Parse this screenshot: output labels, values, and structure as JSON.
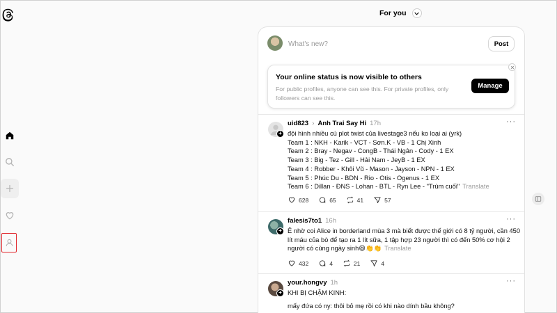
{
  "feed": {
    "title": "For you"
  },
  "composer": {
    "placeholder": "What's new?",
    "post_label": "Post"
  },
  "notice": {
    "title": "Your online status is now visible to others",
    "body": "For public profiles, anyone can see this. For private profiles, only followers can see this.",
    "manage_label": "Manage"
  },
  "posts": [
    {
      "user": "uid823",
      "reply_to": "Anh Trai Say Hi",
      "time": "17h",
      "lines": [
        "đội hình nhiều cú plot twist của livestage3 nếu ko loại ai (yrk)",
        "Team 1 : NKH - Karik - VCT - Sơn.K - VB - 1 Chị Xinh",
        "Team 2 : Bray - Negav - CongB - Thái Ngân - Cody - 1 EX",
        "Team 3 : Big - Tez - Gill - Hải Nam - JeyB - 1 EX",
        "Team 4 : Robber - Khôi Vũ - Mason - Jayson - NPN - 1 EX",
        "Team 5 : Phúc Du - BDN - Rio - Otis - Ogenus - 1 EX",
        "Team 6 : Dillan - ĐNS - Lohan - BTL - Ryn Lee - \"Trùm cuối\""
      ],
      "translate": "Translate",
      "likes": "628",
      "comments": "65",
      "reposts": "41",
      "shares": "57"
    },
    {
      "user": "falesis7to1",
      "time": "16h",
      "lines": [
        "Ê nhờ coi Alice in borderland mùa 3 mà biết được thế giới có 8 tỷ người, cần 450",
        "lít máu của bò để tạo ra 1 lít sữa, 1 tập hợp 23 người thì có đến 50% cơ hội 2",
        "người có cùng ngày sinh😆👏👏"
      ],
      "translate": "Translate",
      "likes": "432",
      "comments": "4",
      "reposts": "21",
      "shares": "4"
    },
    {
      "user": "your.hongvy",
      "time": "1h",
      "lines": [
        "KHI BỊ CHẬM KINH:",
        "",
        "mấy đứa có ny: thôi bỏ mẹ rồi có khi nào dính bầu không?"
      ]
    }
  ],
  "colors": {
    "accent": "#000000",
    "muted": "#9a9a9a",
    "highlight_box": "#e0262b"
  }
}
